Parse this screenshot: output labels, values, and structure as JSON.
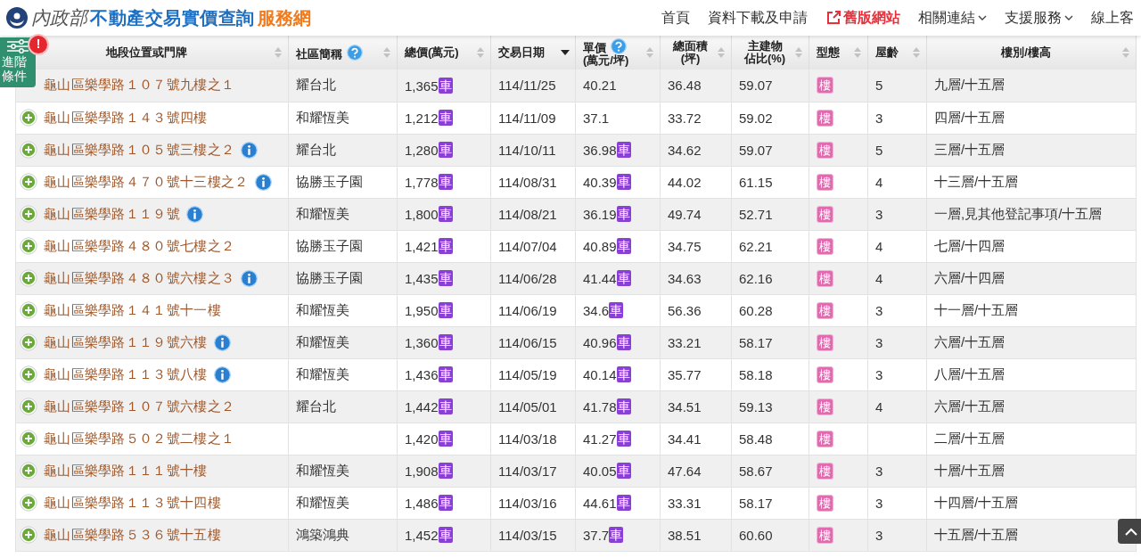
{
  "header": {
    "ministry": "內政部",
    "title": "不動產交易實價查詢",
    "title_suffix": "服務網",
    "nav": [
      {
        "label": "首頁",
        "kind": "plain"
      },
      {
        "label": "資料下載及申請",
        "kind": "plain"
      },
      {
        "label": "舊版網站",
        "kind": "external"
      },
      {
        "label": "相關連結",
        "kind": "dropdown"
      },
      {
        "label": "支援服務",
        "kind": "dropdown"
      },
      {
        "label": "線上客",
        "kind": "plain"
      }
    ]
  },
  "filter_button": {
    "label": "進階條件",
    "badge": "!"
  },
  "table": {
    "columns": [
      {
        "lines": [
          "地段位置或門牌"
        ],
        "help": false,
        "sorted": false
      },
      {
        "lines": [
          "社區簡稱"
        ],
        "help": true,
        "sorted": false
      },
      {
        "lines": [
          "總價(萬元)"
        ],
        "help": false,
        "sorted": false
      },
      {
        "lines": [
          "交易日期"
        ],
        "help": false,
        "sorted": true
      },
      {
        "lines": [
          "單價",
          "(萬元/坪)"
        ],
        "help": true,
        "sorted": false
      },
      {
        "lines": [
          "總面積",
          "(坪)"
        ],
        "help": false,
        "sorted": false
      },
      {
        "lines": [
          "主建物",
          "佔比(%)"
        ],
        "help": false,
        "sorted": false
      },
      {
        "lines": [
          "型態"
        ],
        "help": false,
        "sorted": false
      },
      {
        "lines": [
          "屋齡"
        ],
        "help": false,
        "sorted": false
      },
      {
        "lines": [
          "樓別/樓高"
        ],
        "help": false,
        "sorted": false
      }
    ],
    "rows": [
      {
        "address": "龜山區樂學路１０７號九樓之１",
        "info": false,
        "community": "耀台北",
        "total": "1,365",
        "total_tag": "車",
        "date": "114/11/25",
        "unit": "40.21",
        "area": "36.48",
        "ratio": "59.07",
        "type": "樓",
        "age": "5",
        "floor": "九層/十五層"
      },
      {
        "address": "龜山區樂學路１４３號四樓",
        "info": false,
        "community": "和耀恆美",
        "total": "1,212",
        "total_tag": "車",
        "date": "114/11/09",
        "unit": "37.1",
        "area": "33.72",
        "ratio": "59.02",
        "type": "樓",
        "age": "3",
        "floor": "四層/十五層"
      },
      {
        "address": "龜山區樂學路１０５號三樓之２",
        "info": true,
        "community": "耀台北",
        "total": "1,280",
        "total_tag": "車",
        "date": "114/10/11",
        "unit": "36.98",
        "unit_tag": "車",
        "area": "34.62",
        "ratio": "59.07",
        "type": "樓",
        "age": "5",
        "floor": "三層/十五層"
      },
      {
        "address": "龜山區樂學路４７０號十三樓之２",
        "info": true,
        "community": "協勝玉子園",
        "total": "1,778",
        "total_tag": "車",
        "date": "114/08/31",
        "unit": "40.39",
        "unit_tag": "車",
        "area": "44.02",
        "ratio": "61.15",
        "type": "樓",
        "age": "4",
        "floor": "十三層/十五層"
      },
      {
        "address": "龜山區樂學路１１９號",
        "info": true,
        "community": "和耀恆美",
        "total": "1,800",
        "total_tag": "車",
        "date": "114/08/21",
        "unit": "36.19",
        "unit_tag": "車",
        "area": "49.74",
        "ratio": "52.71",
        "type": "樓",
        "age": "3",
        "floor": "一層,見其他登記事項/十五層"
      },
      {
        "address": "龜山區樂學路４８０號七樓之２",
        "info": false,
        "community": "協勝玉子園",
        "total": "1,421",
        "total_tag": "車",
        "date": "114/07/04",
        "unit": "40.89",
        "unit_tag": "車",
        "area": "34.75",
        "ratio": "62.21",
        "type": "樓",
        "age": "4",
        "floor": "七層/十四層"
      },
      {
        "address": "龜山區樂學路４８０號六樓之３",
        "info": true,
        "community": "協勝玉子園",
        "total": "1,435",
        "total_tag": "車",
        "date": "114/06/28",
        "unit": "41.44",
        "unit_tag": "車",
        "area": "34.63",
        "ratio": "62.16",
        "type": "樓",
        "age": "4",
        "floor": "六層/十四層"
      },
      {
        "address": "龜山區樂學路１４１號十一樓",
        "info": false,
        "community": "和耀恆美",
        "total": "1,950",
        "total_tag": "車",
        "date": "114/06/19",
        "unit": "34.6",
        "unit_tag": "車",
        "area": "56.36",
        "ratio": "60.28",
        "type": "樓",
        "age": "3",
        "floor": "十一層/十五層"
      },
      {
        "address": "龜山區樂學路１１９號六樓",
        "info": true,
        "community": "和耀恆美",
        "total": "1,360",
        "total_tag": "車",
        "date": "114/06/15",
        "unit": "40.96",
        "unit_tag": "車",
        "area": "33.21",
        "ratio": "58.17",
        "type": "樓",
        "age": "3",
        "floor": "六層/十五層"
      },
      {
        "address": "龜山區樂學路１１３號八樓",
        "info": true,
        "community": "和耀恆美",
        "total": "1,436",
        "total_tag": "車",
        "date": "114/05/19",
        "unit": "40.14",
        "unit_tag": "車",
        "area": "35.77",
        "ratio": "58.18",
        "type": "樓",
        "age": "3",
        "floor": "八層/十五層"
      },
      {
        "address": "龜山區樂學路１０７號六樓之２",
        "info": false,
        "community": "耀台北",
        "total": "1,442",
        "total_tag": "車",
        "date": "114/05/01",
        "unit": "41.78",
        "unit_tag": "車",
        "area": "34.51",
        "ratio": "59.13",
        "type": "樓",
        "age": "4",
        "floor": "六層/十五層"
      },
      {
        "address": "龜山區樂學路５０２號二樓之１",
        "info": false,
        "total": "1,420",
        "total_tag": "車",
        "date": "114/03/18",
        "unit": "41.27",
        "unit_tag": "車",
        "area": "34.41",
        "ratio": "58.48",
        "type": "樓",
        "floor": "二層/十五層"
      },
      {
        "address": "龜山區樂學路１１１號十樓",
        "info": false,
        "community": "和耀恆美",
        "total": "1,908",
        "total_tag": "車",
        "date": "114/03/17",
        "unit": "40.05",
        "unit_tag": "車",
        "area": "47.64",
        "ratio": "58.67",
        "type": "樓",
        "age": "3",
        "floor": "十層/十五層"
      },
      {
        "address": "龜山區樂學路１１３號十四樓",
        "info": false,
        "community": "和耀恆美",
        "total": "1,486",
        "total_tag": "車",
        "date": "114/03/16",
        "unit": "44.61",
        "unit_tag": "車",
        "area": "33.31",
        "ratio": "58.17",
        "type": "樓",
        "age": "3",
        "floor": "十四層/十五層"
      },
      {
        "address": "龜山區樂學路５３６號十五樓",
        "info": false,
        "community": "鴻築鴻典",
        "total": "1,452",
        "total_tag": "車",
        "date": "114/03/15",
        "unit": "37.7",
        "unit_tag": "車",
        "area": "38.51",
        "ratio": "60.60",
        "type": "樓",
        "age": "3",
        "floor": "十五層/十五層"
      }
    ]
  }
}
